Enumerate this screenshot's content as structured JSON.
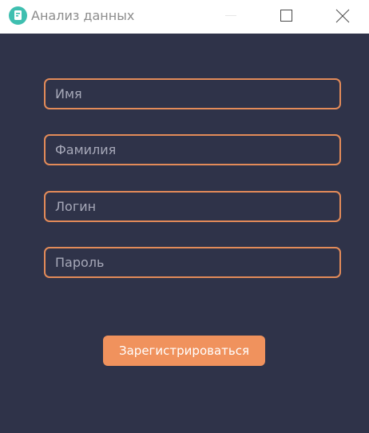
{
  "window": {
    "title": "Анализ данных",
    "icon": "analytics-app-icon",
    "controls": [
      "minimize-icon",
      "maximize-icon",
      "close-icon"
    ]
  },
  "form": {
    "fields": [
      {
        "name": "first-name",
        "placeholder": "Имя",
        "value": ""
      },
      {
        "name": "last-name",
        "placeholder": "Фамилия",
        "value": ""
      },
      {
        "name": "login",
        "placeholder": "Логин",
        "value": ""
      },
      {
        "name": "password",
        "placeholder": "Пароль",
        "value": ""
      }
    ],
    "submit_label": "Зарегистрироваться"
  },
  "colors": {
    "background": "#2f3349",
    "accent": "#f0925d",
    "field_border": "#e38b59",
    "titlebar": "#ffffff",
    "app_icon": "#3fbfb0"
  }
}
